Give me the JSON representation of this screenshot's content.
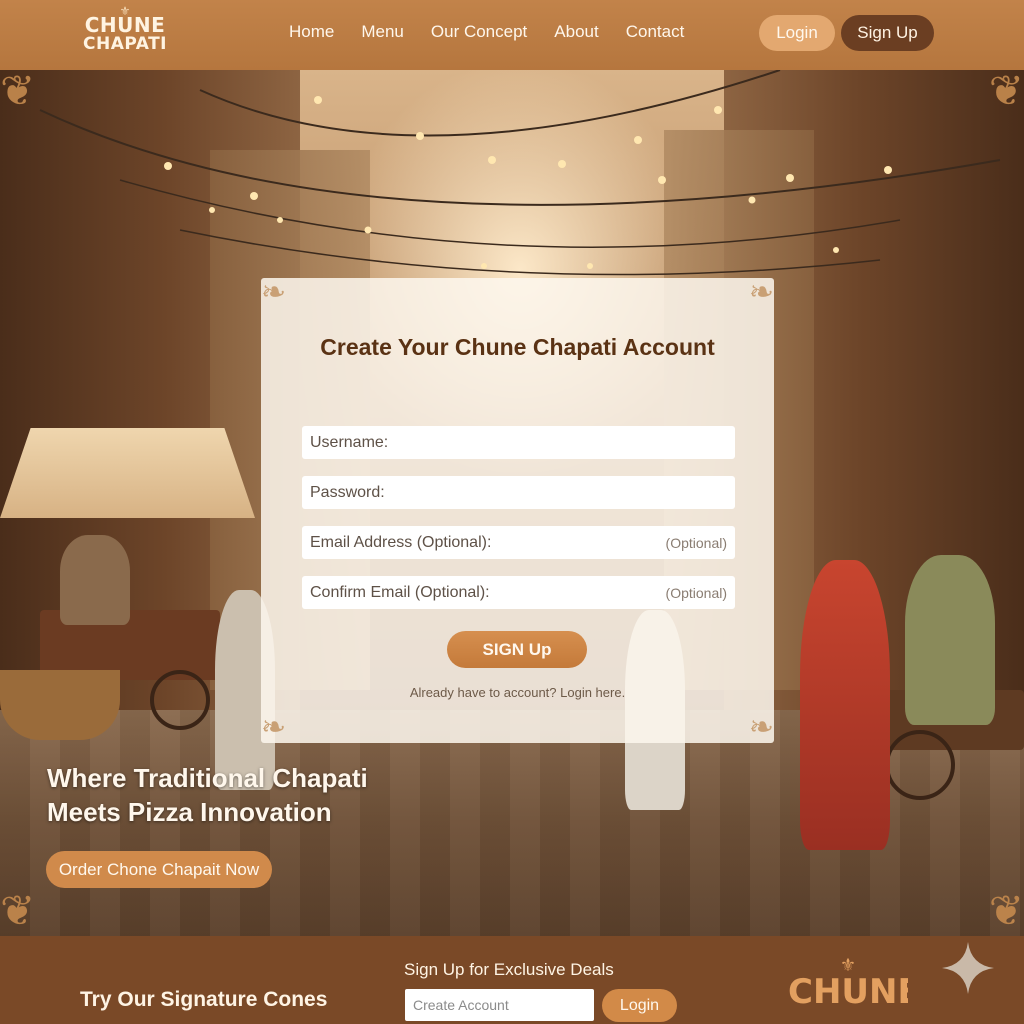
{
  "brand": {
    "logo_line1": "CHUNE",
    "logo_line2": "CHAPATI"
  },
  "nav": {
    "items": [
      "Home",
      "Menu",
      "Our Concept",
      "About",
      "Contact"
    ]
  },
  "header": {
    "login_label": "Login",
    "signup_label": "Sign Up"
  },
  "form": {
    "title": "Create Your Chune Chapati Account",
    "username_placeholder": "Username:",
    "password_placeholder": "Password:",
    "email_placeholder": "Email Address (Optional):",
    "email_hint": "(Optional)",
    "confirm_email_placeholder": "Confirm Email (Optional):",
    "confirm_email_hint": "(Optional)",
    "submit_label": "SIGN Up",
    "login_prompt": "Already have to account? Login here."
  },
  "hero": {
    "heading_line1": "Where Traditional Chapati",
    "heading_line2": "Meets Pizza Innovation",
    "cta_label": "Order Chone Chapait Now"
  },
  "footer": {
    "tagline": "Try Our Signature Cones",
    "deals_title": "Sign Up for Exclusive Deals",
    "create_placeholder": "Create Account",
    "login_label": "Login",
    "logo_word": "CHUNE"
  },
  "colors": {
    "header_bg": "#b5763e",
    "primary_button": "#d08a4b",
    "dark_button": "#6b3e22",
    "footer_bg": "#7a4927",
    "title_text": "#5a3214"
  }
}
